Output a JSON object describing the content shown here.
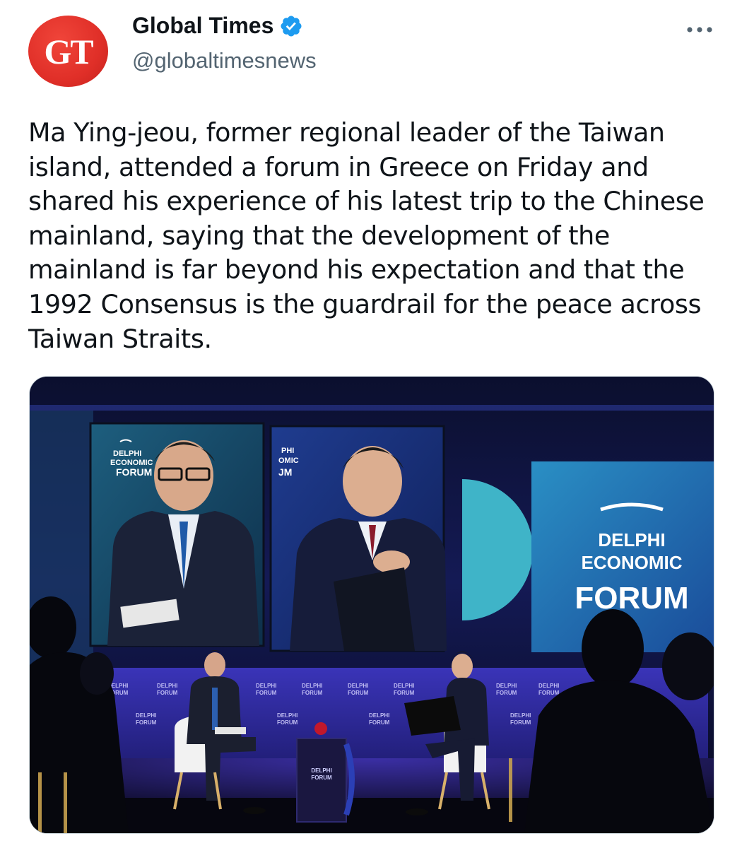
{
  "author": {
    "display_name": "Global Times",
    "handle": "@globaltimesnews",
    "avatar_text": "GT",
    "verified": true,
    "verified_icon": "verified-badge-icon",
    "avatar_color": "#e02f28"
  },
  "more_icon": "more-horizontal-icon",
  "tweet": {
    "text": "Ma Ying-jeou, former regional leader of the Taiwan island, attended a forum in Greece on Friday and shared his experience of his latest trip to the Chinese mainland, saying that the development of the mainland is far beyond his expectation and that the 1992 Consensus is the guardrail for the peace across Taiwan Straits."
  },
  "media": {
    "stage_sign": {
      "line1": "DELPHI",
      "line2": "ECONOMIC",
      "line3": "FORUM"
    },
    "colors": {
      "backdrop": "#1b1f6e",
      "accent": "#4a3fd1",
      "teal": "#3fb4c8"
    }
  },
  "colors": {
    "text": "#0f1419",
    "secondary_text": "#536471",
    "verified_blue": "#1d9bf0",
    "border": "#cfd9de"
  }
}
